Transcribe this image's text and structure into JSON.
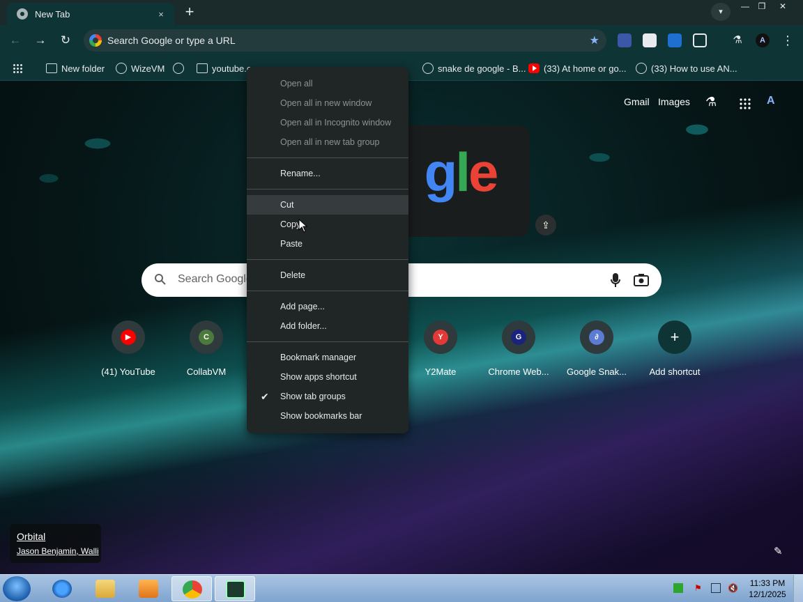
{
  "browser": {
    "tab": {
      "title": "New Tab",
      "close": "×"
    },
    "new_tab": "+",
    "window_controls": {
      "minimize": "—",
      "restore": "❐",
      "close": "✕"
    },
    "nav": {
      "back": "←",
      "forward": "→",
      "reload": "↻"
    },
    "omnibox": {
      "text": "Search Google or type a URL"
    },
    "menu": "⋮",
    "profile_initials": "A"
  },
  "bookmarks": [
    {
      "label": "",
      "icon": "apps-icon"
    },
    {
      "label": "New folder",
      "icon": "folder-icon"
    },
    {
      "label": "WizeVM",
      "icon": "globe-icon"
    },
    {
      "label": "",
      "icon": "globe-icon"
    },
    {
      "label": "youtube.com",
      "icon": "folder-icon"
    },
    {
      "label": "snake de google - B...",
      "icon": "globe-icon"
    },
    {
      "label": "(33) At home or go...",
      "icon": "youtube-icon"
    },
    {
      "label": "(33) How to use AN...",
      "icon": "globe-icon"
    }
  ],
  "ntp": {
    "top_links": {
      "gmail": "Gmail",
      "images": "Images"
    },
    "search_placeholder": "Search Google",
    "doodle_letters": [
      "g",
      "l",
      "e"
    ],
    "shortcuts": [
      {
        "label": "(41) YouTube",
        "letter": "▶",
        "color": "#ff0000"
      },
      {
        "label": "CollabVM",
        "letter": "C",
        "color": "#4c7a3c"
      },
      {
        "label": "Y2Mate",
        "letter": "Y",
        "color": "#e53935"
      },
      {
        "label": "Chrome Web...",
        "letter": "G",
        "color": "#1a237e"
      },
      {
        "label": "Google Snak...",
        "letter": "∂",
        "color": "#5b7bd5"
      },
      {
        "label": "Add shortcut",
        "letter": "+",
        "color": "#0f3436"
      }
    ],
    "attribution": {
      "title": "Orbital",
      "author": "Jason Benjamin, Walli"
    }
  },
  "context_menu": {
    "groups": [
      [
        {
          "label": "Open all",
          "disabled": true
        },
        {
          "label": "Open all in new window",
          "disabled": true
        },
        {
          "label": "Open all in Incognito window",
          "disabled": true
        },
        {
          "label": "Open all in new tab group",
          "disabled": true
        }
      ],
      [
        {
          "label": "Rename..."
        }
      ],
      [
        {
          "label": "Cut",
          "hover": true
        },
        {
          "label": "Copy"
        },
        {
          "label": "Paste"
        }
      ],
      [
        {
          "label": "Delete"
        }
      ],
      [
        {
          "label": "Add page..."
        },
        {
          "label": "Add folder..."
        }
      ],
      [
        {
          "label": "Bookmark manager"
        },
        {
          "label": "Show apps shortcut"
        },
        {
          "label": "Show tab groups",
          "checked": true
        },
        {
          "label": "Show bookmarks bar"
        }
      ]
    ]
  },
  "taskbar": {
    "clock": {
      "time": "11:33 PM",
      "date": "12/1/2025"
    }
  }
}
